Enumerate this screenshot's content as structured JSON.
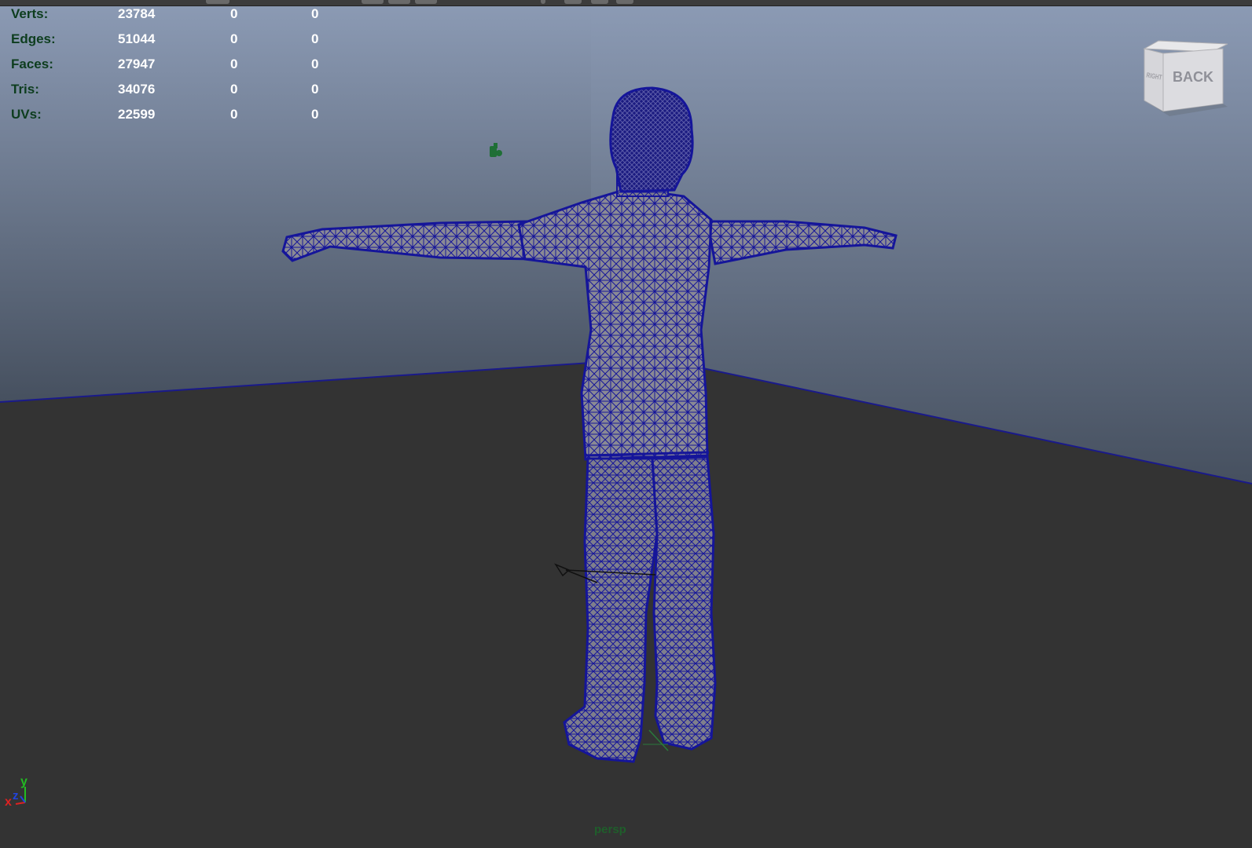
{
  "hud": {
    "stats": [
      {
        "label": "Verts:",
        "values": [
          "23784",
          "0",
          "0"
        ]
      },
      {
        "label": "Edges:",
        "values": [
          "51044",
          "0",
          "0"
        ]
      },
      {
        "label": "Faces:",
        "values": [
          "27947",
          "0",
          "0"
        ]
      },
      {
        "label": "Tris:",
        "values": [
          "34076",
          "0",
          "0"
        ]
      },
      {
        "label": "UVs:",
        "values": [
          "22599",
          "0",
          "0"
        ]
      }
    ]
  },
  "viewcube": {
    "front_face": "BACK",
    "side_face": "RIGHT"
  },
  "axis": {
    "x": "x",
    "y": "y",
    "z": "z"
  },
  "camera_label": "persp",
  "colors": {
    "wireframe": "#15159a",
    "mesh_fill": "#8a8a94",
    "floor": "#333333",
    "sky_top": "#8c9bb5",
    "sky_bottom": "#4b5566",
    "hud_label": "#0d3d1e",
    "hud_value": "#ffffff"
  },
  "icons": [
    "viewcube-icon",
    "axis-triad-icon",
    "light-icon",
    "camera-icon",
    "manipulator-icon"
  ]
}
